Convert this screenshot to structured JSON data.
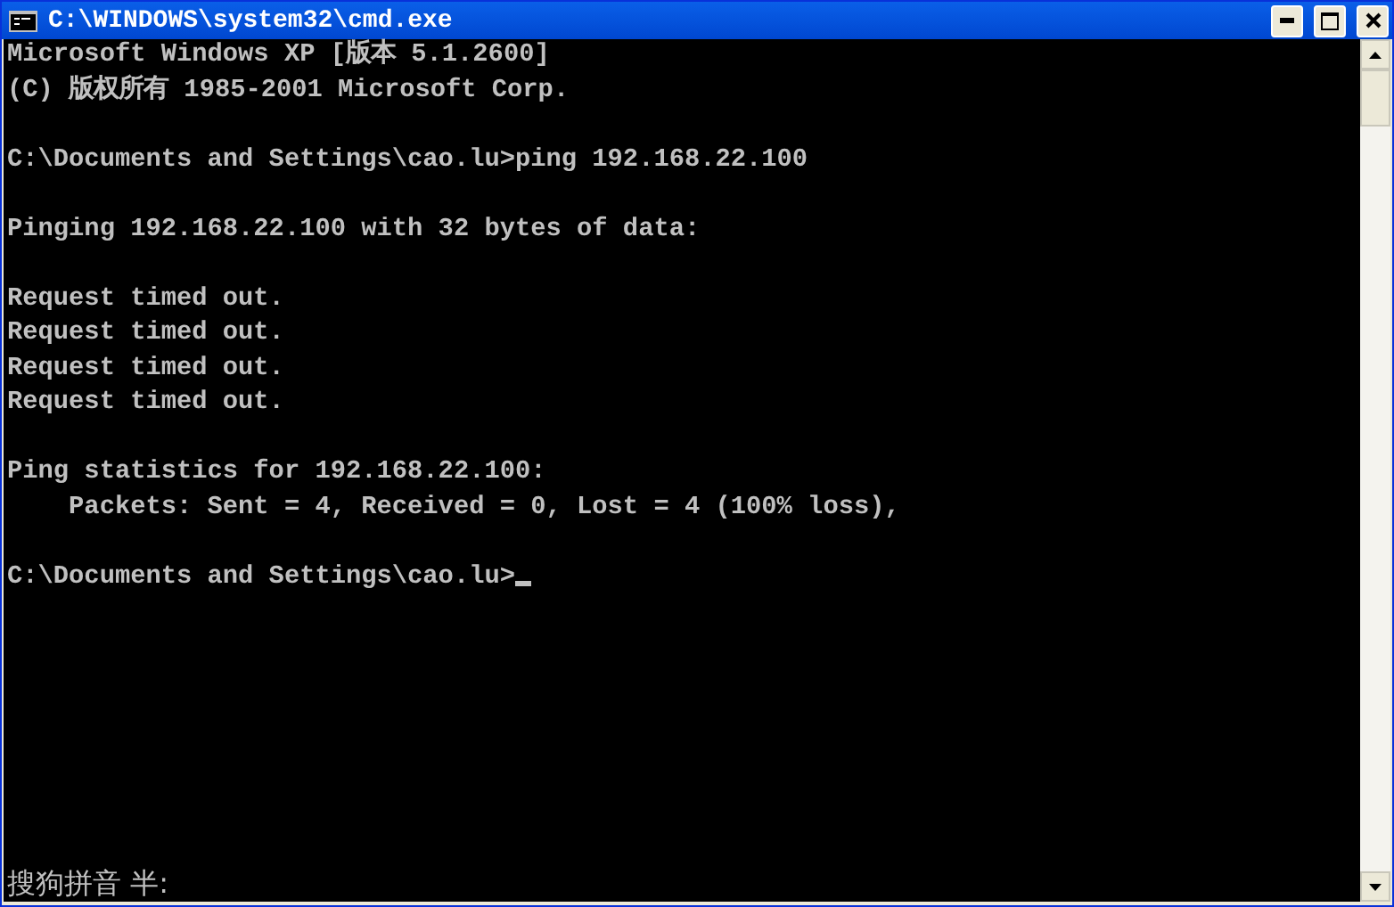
{
  "window": {
    "title": "C:\\WINDOWS\\system32\\cmd.exe"
  },
  "console": {
    "blocks": [
      [
        "Microsoft Windows XP [版本 5.1.2600]",
        "(C) 版权所有 1985-2001 Microsoft Corp."
      ],
      [
        "C:\\Documents and Settings\\cao.lu>ping 192.168.22.100"
      ],
      [
        "Pinging 192.168.22.100 with 32 bytes of data:"
      ],
      [
        "Request timed out.",
        "Request timed out.",
        "Request timed out.",
        "Request timed out."
      ],
      [
        "Ping statistics for 192.168.22.100:",
        "    Packets: Sent = 4, Received = 0, Lost = 4 (100% loss),"
      ],
      [
        "C:\\Documents and Settings\\cao.lu>"
      ]
    ],
    "cursor": true
  },
  "ime_status": "搜狗拼音 半:"
}
